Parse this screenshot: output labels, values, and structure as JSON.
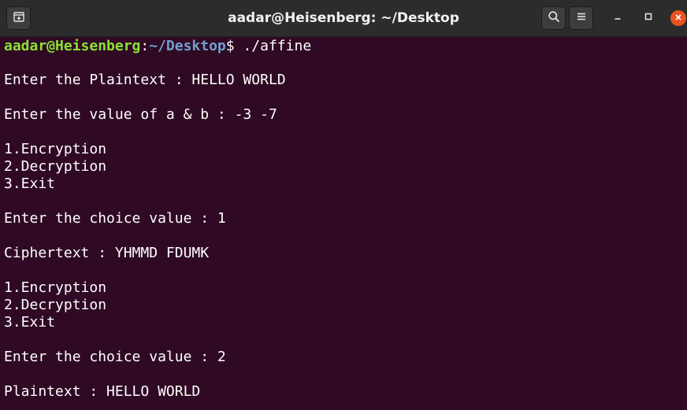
{
  "window": {
    "title": "aadar@Heisenberg: ~/Desktop"
  },
  "colors": {
    "terminal_bg": "#300a24",
    "titlebar_bg": "#2c2c2c",
    "prompt_user": "#8ae234",
    "prompt_path": "#729fcf",
    "text": "#ffffff",
    "close_button": "#e95420"
  },
  "icons": {
    "new_tab": "new-tab-icon",
    "search": "search-icon",
    "menu": "hamburger-menu-icon",
    "minimize": "minimize-icon",
    "maximize": "maximize-icon",
    "close": "close-icon"
  },
  "prompt": {
    "user_host": "aadar@Heisenberg",
    "colon": ":",
    "path": "~/Desktop",
    "symbol": "$",
    "command": " ./affine"
  },
  "output": [
    "Enter the Plaintext : HELLO WORLD",
    "Enter the value of a & b : -3 -7",
    "1.Encryption",
    "2.Decryption",
    "3.Exit",
    "Enter the choice value : 1",
    "Ciphertext : YHMMD FDUMK",
    "1.Encryption",
    "2.Decryption",
    "3.Exit",
    "Enter the choice value : 2",
    "Plaintext : HELLO WORLD"
  ]
}
